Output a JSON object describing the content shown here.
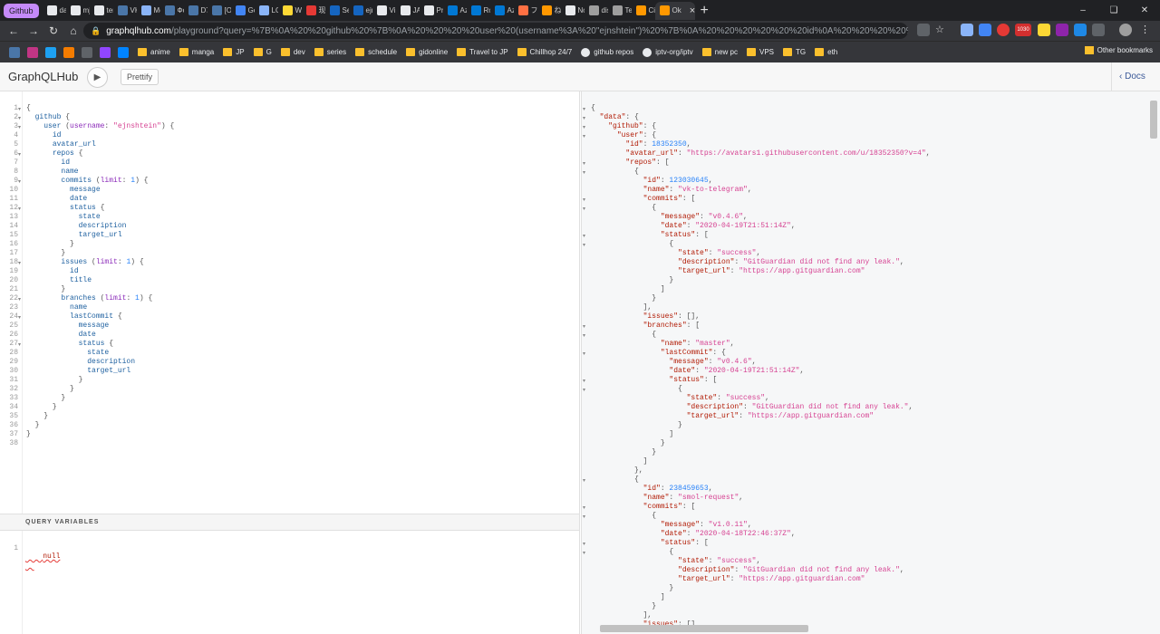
{
  "browser": {
    "tab_group_label": "Github",
    "tabs": [
      "das",
      "mjr",
      "terl",
      "VK",
      "Me",
      "Фо",
      "D7",
      "[ON",
      "Go",
      "LO",
      "WC",
      "现代",
      "Ser",
      "ejn",
      "Vin",
      "JAX",
      "Pro",
      "Azu",
      "Roc",
      "Azu",
      "フォ",
      "ねん",
      "No",
      "dis",
      "Tel",
      "Cig",
      "Ok"
    ],
    "active_tab_index": 26,
    "url_host": "graphqlhub.com",
    "url_path": "/playground?query=%7B%0A%20%20github%20%7B%0A%20%20%20%20user%20(username%3A%20\"ejnshtein\")%20%7B%0A%20%20%20%20%20%20id%0A%20%20%20%20%20%20avatar_url...",
    "badge_count": "1030",
    "bookmarks": [
      "anime",
      "manga",
      "JP",
      "G",
      "dev",
      "series",
      "schedule",
      "gidonline",
      "Travel to JP",
      "Chillhop 24/7",
      "github repos",
      "iptv-org/iptv",
      "new pc",
      "VPS",
      "TG",
      "eth"
    ],
    "other_bookmarks": "Other bookmarks"
  },
  "header": {
    "title": "GraphQLHub",
    "prettify_label": "Prettify",
    "docs_label": "Docs"
  },
  "query_variables": {
    "title": "QUERY VARIABLES",
    "value": "null"
  },
  "query_lines": [
    [
      [
        "",
        "{"
      ]
    ],
    [
      [
        "",
        "  "
      ],
      [
        "f",
        "github"
      ],
      [
        "",
        " {"
      ]
    ],
    [
      [
        "",
        "    "
      ],
      [
        "f",
        "user"
      ],
      [
        "",
        " ("
      ],
      [
        "a",
        "username"
      ],
      [
        "",
        ": "
      ],
      [
        "s",
        "\"ejnshtein\""
      ],
      [
        "",
        ") {"
      ]
    ],
    [
      [
        "",
        "      "
      ],
      [
        "f",
        "id"
      ]
    ],
    [
      [
        "",
        "      "
      ],
      [
        "f",
        "avatar_url"
      ]
    ],
    [
      [
        "",
        "      "
      ],
      [
        "f",
        "repos"
      ],
      [
        "",
        " {"
      ]
    ],
    [
      [
        "",
        "        "
      ],
      [
        "f",
        "id"
      ]
    ],
    [
      [
        "",
        "        "
      ],
      [
        "f",
        "name"
      ]
    ],
    [
      [
        "",
        "        "
      ],
      [
        "f",
        "commits"
      ],
      [
        "",
        " ("
      ],
      [
        "a",
        "limit"
      ],
      [
        "",
        ": "
      ],
      [
        "n",
        "1"
      ],
      [
        "",
        ") {"
      ]
    ],
    [
      [
        "",
        "          "
      ],
      [
        "f",
        "message"
      ]
    ],
    [
      [
        "",
        "          "
      ],
      [
        "f",
        "date"
      ]
    ],
    [
      [
        "",
        "          "
      ],
      [
        "f",
        "status"
      ],
      [
        "",
        " {"
      ]
    ],
    [
      [
        "",
        "            "
      ],
      [
        "f",
        "state"
      ]
    ],
    [
      [
        "",
        "            "
      ],
      [
        "f",
        "description"
      ]
    ],
    [
      [
        "",
        "            "
      ],
      [
        "f",
        "target_url"
      ]
    ],
    [
      [
        "",
        "          }"
      ]
    ],
    [
      [
        "",
        "        }"
      ]
    ],
    [
      [
        "",
        "        "
      ],
      [
        "f",
        "issues"
      ],
      [
        "",
        " ("
      ],
      [
        "a",
        "limit"
      ],
      [
        "",
        ": "
      ],
      [
        "n",
        "1"
      ],
      [
        "",
        ") {"
      ]
    ],
    [
      [
        "",
        "          "
      ],
      [
        "f",
        "id"
      ]
    ],
    [
      [
        "",
        "          "
      ],
      [
        "f",
        "title"
      ]
    ],
    [
      [
        "",
        "        }"
      ]
    ],
    [
      [
        "",
        "        "
      ],
      [
        "f",
        "branches"
      ],
      [
        "",
        " ("
      ],
      [
        "a",
        "limit"
      ],
      [
        "",
        ": "
      ],
      [
        "n",
        "1"
      ],
      [
        "",
        ") {"
      ]
    ],
    [
      [
        "",
        "          "
      ],
      [
        "f",
        "name"
      ]
    ],
    [
      [
        "",
        "          "
      ],
      [
        "f",
        "lastCommit"
      ],
      [
        "",
        " {"
      ]
    ],
    [
      [
        "",
        "            "
      ],
      [
        "f",
        "message"
      ]
    ],
    [
      [
        "",
        "            "
      ],
      [
        "f",
        "date"
      ]
    ],
    [
      [
        "",
        "            "
      ],
      [
        "f",
        "status"
      ],
      [
        "",
        " {"
      ]
    ],
    [
      [
        "",
        "              "
      ],
      [
        "f",
        "state"
      ]
    ],
    [
      [
        "",
        "              "
      ],
      [
        "f",
        "description"
      ]
    ],
    [
      [
        "",
        "              "
      ],
      [
        "f",
        "target_url"
      ]
    ],
    [
      [
        "",
        "            }"
      ]
    ],
    [
      [
        "",
        "          }"
      ]
    ],
    [
      [
        "",
        "        }"
      ]
    ],
    [
      [
        "",
        "      }"
      ]
    ],
    [
      [
        "",
        "    }"
      ]
    ],
    [
      [
        "",
        "  }"
      ]
    ],
    [
      [
        "",
        "}"
      ]
    ],
    [
      [
        "",
        ""
      ]
    ]
  ],
  "result_lines": [
    [
      [
        "",
        "{"
      ]
    ],
    [
      [
        "",
        "  "
      ],
      [
        "k",
        "\"data\""
      ],
      [
        "",
        ": {"
      ]
    ],
    [
      [
        "",
        "    "
      ],
      [
        "k",
        "\"github\""
      ],
      [
        "",
        ": {"
      ]
    ],
    [
      [
        "",
        "      "
      ],
      [
        "k",
        "\"user\""
      ],
      [
        "",
        ": {"
      ]
    ],
    [
      [
        "",
        "        "
      ],
      [
        "k",
        "\"id\""
      ],
      [
        "",
        ": "
      ],
      [
        "n",
        "18352350"
      ],
      [
        "",
        ","
      ]
    ],
    [
      [
        "",
        "        "
      ],
      [
        "k",
        "\"avatar_url\""
      ],
      [
        "",
        ": "
      ],
      [
        "s",
        "\"https://avatars1.githubusercontent.com/u/18352350?v=4\""
      ],
      [
        "",
        ","
      ]
    ],
    [
      [
        "",
        "        "
      ],
      [
        "k",
        "\"repos\""
      ],
      [
        "",
        ": ["
      ]
    ],
    [
      [
        "",
        "          {"
      ]
    ],
    [
      [
        "",
        "            "
      ],
      [
        "k",
        "\"id\""
      ],
      [
        "",
        ": "
      ],
      [
        "n",
        "123030645"
      ],
      [
        "",
        ","
      ]
    ],
    [
      [
        "",
        "            "
      ],
      [
        "k",
        "\"name\""
      ],
      [
        "",
        ": "
      ],
      [
        "s",
        "\"vk-to-telegram\""
      ],
      [
        "",
        ","
      ]
    ],
    [
      [
        "",
        "            "
      ],
      [
        "k",
        "\"commits\""
      ],
      [
        "",
        ": ["
      ]
    ],
    [
      [
        "",
        "              {"
      ]
    ],
    [
      [
        "",
        "                "
      ],
      [
        "k",
        "\"message\""
      ],
      [
        "",
        ": "
      ],
      [
        "s",
        "\"v0.4.6\""
      ],
      [
        "",
        ","
      ]
    ],
    [
      [
        "",
        "                "
      ],
      [
        "k",
        "\"date\""
      ],
      [
        "",
        ": "
      ],
      [
        "s",
        "\"2020-04-19T21:51:14Z\""
      ],
      [
        "",
        ","
      ]
    ],
    [
      [
        "",
        "                "
      ],
      [
        "k",
        "\"status\""
      ],
      [
        "",
        ": ["
      ]
    ],
    [
      [
        "",
        "                  {"
      ]
    ],
    [
      [
        "",
        "                    "
      ],
      [
        "k",
        "\"state\""
      ],
      [
        "",
        ": "
      ],
      [
        "s",
        "\"success\""
      ],
      [
        "",
        ","
      ]
    ],
    [
      [
        "",
        "                    "
      ],
      [
        "k",
        "\"description\""
      ],
      [
        "",
        ": "
      ],
      [
        "s",
        "\"GitGuardian did not find any leak.\""
      ],
      [
        "",
        ","
      ]
    ],
    [
      [
        "",
        "                    "
      ],
      [
        "k",
        "\"target_url\""
      ],
      [
        "",
        ": "
      ],
      [
        "s",
        "\"https://app.gitguardian.com\""
      ]
    ],
    [
      [
        "",
        "                  }"
      ]
    ],
    [
      [
        "",
        "                ]"
      ]
    ],
    [
      [
        "",
        "              }"
      ]
    ],
    [
      [
        "",
        "            ],"
      ]
    ],
    [
      [
        "",
        "            "
      ],
      [
        "k",
        "\"issues\""
      ],
      [
        "",
        ": [],"
      ]
    ],
    [
      [
        "",
        "            "
      ],
      [
        "k",
        "\"branches\""
      ],
      [
        "",
        ": ["
      ]
    ],
    [
      [
        "",
        "              {"
      ]
    ],
    [
      [
        "",
        "                "
      ],
      [
        "k",
        "\"name\""
      ],
      [
        "",
        ": "
      ],
      [
        "s",
        "\"master\""
      ],
      [
        "",
        ","
      ]
    ],
    [
      [
        "",
        "                "
      ],
      [
        "k",
        "\"lastCommit\""
      ],
      [
        "",
        ": {"
      ]
    ],
    [
      [
        "",
        "                  "
      ],
      [
        "k",
        "\"message\""
      ],
      [
        "",
        ": "
      ],
      [
        "s",
        "\"v0.4.6\""
      ],
      [
        "",
        ","
      ]
    ],
    [
      [
        "",
        "                  "
      ],
      [
        "k",
        "\"date\""
      ],
      [
        "",
        ": "
      ],
      [
        "s",
        "\"2020-04-19T21:51:14Z\""
      ],
      [
        "",
        ","
      ]
    ],
    [
      [
        "",
        "                  "
      ],
      [
        "k",
        "\"status\""
      ],
      [
        "",
        ": ["
      ]
    ],
    [
      [
        "",
        "                    {"
      ]
    ],
    [
      [
        "",
        "                      "
      ],
      [
        "k",
        "\"state\""
      ],
      [
        "",
        ": "
      ],
      [
        "s",
        "\"success\""
      ],
      [
        "",
        ","
      ]
    ],
    [
      [
        "",
        "                      "
      ],
      [
        "k",
        "\"description\""
      ],
      [
        "",
        ": "
      ],
      [
        "s",
        "\"GitGuardian did not find any leak.\""
      ],
      [
        "",
        ","
      ]
    ],
    [
      [
        "",
        "                      "
      ],
      [
        "k",
        "\"target_url\""
      ],
      [
        "",
        ": "
      ],
      [
        "s",
        "\"https://app.gitguardian.com\""
      ]
    ],
    [
      [
        "",
        "                    }"
      ]
    ],
    [
      [
        "",
        "                  ]"
      ]
    ],
    [
      [
        "",
        "                }"
      ]
    ],
    [
      [
        "",
        "              }"
      ]
    ],
    [
      [
        "",
        "            ]"
      ]
    ],
    [
      [
        "",
        "          },"
      ]
    ],
    [
      [
        "",
        "          {"
      ]
    ],
    [
      [
        "",
        "            "
      ],
      [
        "k",
        "\"id\""
      ],
      [
        "",
        ": "
      ],
      [
        "n",
        "238459653"
      ],
      [
        "",
        ","
      ]
    ],
    [
      [
        "",
        "            "
      ],
      [
        "k",
        "\"name\""
      ],
      [
        "",
        ": "
      ],
      [
        "s",
        "\"smol-request\""
      ],
      [
        "",
        ","
      ]
    ],
    [
      [
        "",
        "            "
      ],
      [
        "k",
        "\"commits\""
      ],
      [
        "",
        ": ["
      ]
    ],
    [
      [
        "",
        "              {"
      ]
    ],
    [
      [
        "",
        "                "
      ],
      [
        "k",
        "\"message\""
      ],
      [
        "",
        ": "
      ],
      [
        "s",
        "\"v1.0.11\""
      ],
      [
        "",
        ","
      ]
    ],
    [
      [
        "",
        "                "
      ],
      [
        "k",
        "\"date\""
      ],
      [
        "",
        ": "
      ],
      [
        "s",
        "\"2020-04-18T22:46:37Z\""
      ],
      [
        "",
        ","
      ]
    ],
    [
      [
        "",
        "                "
      ],
      [
        "k",
        "\"status\""
      ],
      [
        "",
        ": ["
      ]
    ],
    [
      [
        "",
        "                  {"
      ]
    ],
    [
      [
        "",
        "                    "
      ],
      [
        "k",
        "\"state\""
      ],
      [
        "",
        ": "
      ],
      [
        "s",
        "\"success\""
      ],
      [
        "",
        ","
      ]
    ],
    [
      [
        "",
        "                    "
      ],
      [
        "k",
        "\"description\""
      ],
      [
        "",
        ": "
      ],
      [
        "s",
        "\"GitGuardian did not find any leak.\""
      ],
      [
        "",
        ","
      ]
    ],
    [
      [
        "",
        "                    "
      ],
      [
        "k",
        "\"target_url\""
      ],
      [
        "",
        ": "
      ],
      [
        "s",
        "\"https://app.gitguardian.com\""
      ]
    ],
    [
      [
        "",
        "                  }"
      ]
    ],
    [
      [
        "",
        "                ]"
      ]
    ],
    [
      [
        "",
        "              }"
      ]
    ],
    [
      [
        "",
        "            ],"
      ]
    ],
    [
      [
        "",
        "            "
      ],
      [
        "k",
        "\"issues\""
      ],
      [
        "",
        ": []"
      ]
    ]
  ],
  "colors": {
    "tab_group": "#c58af9",
    "field": "#1f61a0",
    "argument": "#8b2bb9",
    "string": "#d64292",
    "number": "#2882f9",
    "key": "#b11a04"
  }
}
